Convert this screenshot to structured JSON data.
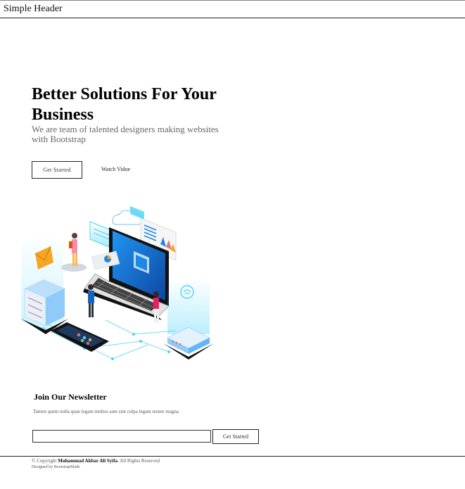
{
  "header": {
    "brand": "Simple Header"
  },
  "hero": {
    "title": "Better Solutions For Your Business",
    "subtitle": "We are team of talented designers making websites with Bootstrap",
    "cta_label": "Get Started",
    "video_label": "Watch Vidoe"
  },
  "newsletter": {
    "title": "Join Our Newsletter",
    "text": "Tamen quem nulla quae legam multos aute sint culpa legam noster magna",
    "input_value": "",
    "button_label": "Get Started"
  },
  "footer": {
    "copyright_prefix": "© Copyright",
    "copyright_name": "Muhammad Akbar Ali Syifa",
    "copyright_suffix": ". All Rights Reserved",
    "credits": "Designed by BootstrapMade"
  },
  "colors": {
    "accent_blue": "#1e88e5",
    "cyan_glow": "#4fd3f5",
    "dark": "#1a1a1a"
  }
}
